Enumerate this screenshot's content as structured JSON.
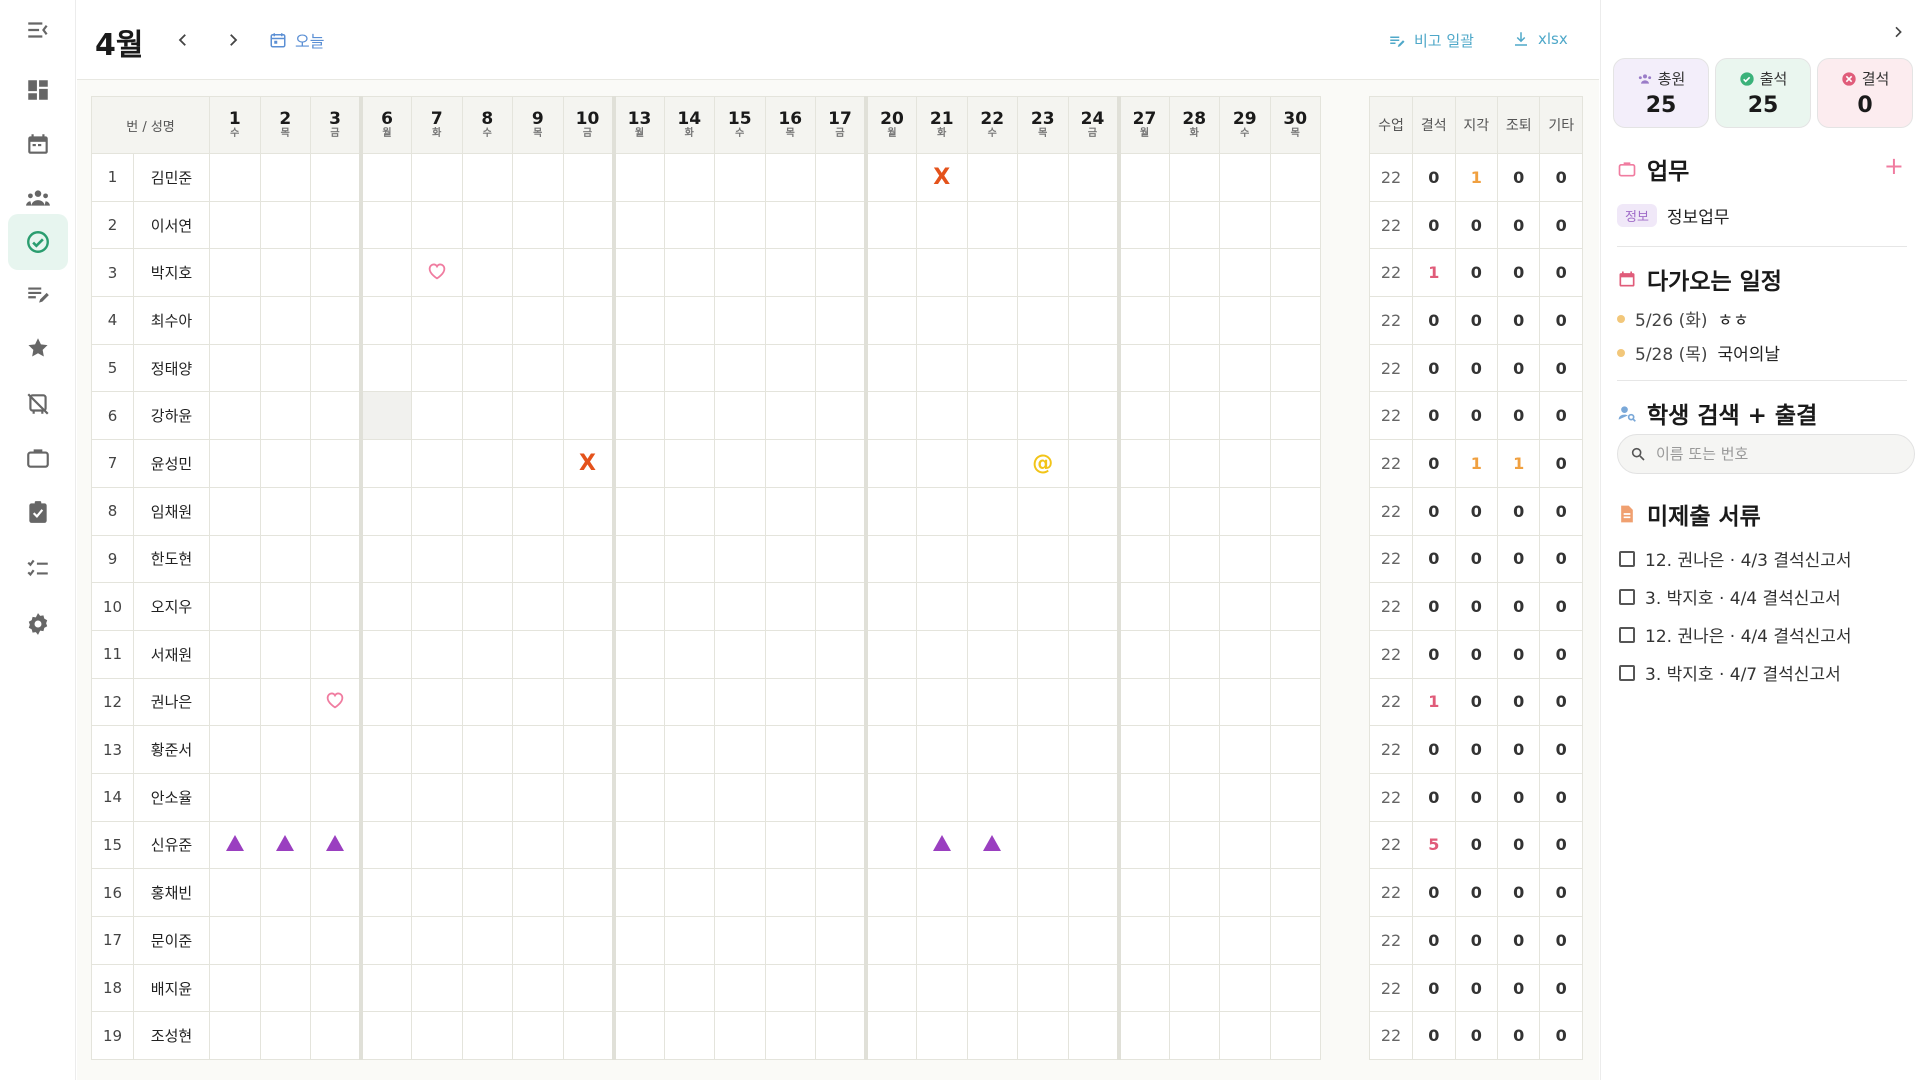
{
  "colors": {
    "accent": "#2a9d6f",
    "absent": "#e4521b",
    "red": "#e05c7a",
    "orange": "#f0a040",
    "purple": "#9a3fc0",
    "pink": "#f07ca0",
    "yellow": "#f2c418"
  },
  "nav": {
    "items": [
      "menu-collapse-icon",
      "dashboard-icon",
      "calendar-icon",
      "group-icon",
      "check-circle-icon",
      "edit-note-icon",
      "star-icon",
      "no-transfer-icon",
      "briefcase-icon",
      "assignment-icon",
      "checklist-icon",
      "settings-icon"
    ]
  },
  "topbar": {
    "month": "4월",
    "today_label": "오늘",
    "notes_label": "비고 일괄",
    "export_label": "xlsx"
  },
  "table": {
    "name_header": "번 / 성명",
    "days": [
      {
        "d": "1",
        "w": "수"
      },
      {
        "d": "2",
        "w": "목"
      },
      {
        "d": "3",
        "w": "금"
      },
      {
        "d": "6",
        "w": "월"
      },
      {
        "d": "7",
        "w": "화"
      },
      {
        "d": "8",
        "w": "수"
      },
      {
        "d": "9",
        "w": "목"
      },
      {
        "d": "10",
        "w": "금"
      },
      {
        "d": "13",
        "w": "월"
      },
      {
        "d": "14",
        "w": "화"
      },
      {
        "d": "15",
        "w": "수"
      },
      {
        "d": "16",
        "w": "목"
      },
      {
        "d": "17",
        "w": "금"
      },
      {
        "d": "20",
        "w": "월"
      },
      {
        "d": "21",
        "w": "화"
      },
      {
        "d": "22",
        "w": "수"
      },
      {
        "d": "23",
        "w": "목"
      },
      {
        "d": "24",
        "w": "금"
      },
      {
        "d": "27",
        "w": "월"
      },
      {
        "d": "28",
        "w": "화"
      },
      {
        "d": "29",
        "w": "수"
      },
      {
        "d": "30",
        "w": "목"
      }
    ],
    "stat_headers": [
      "수업",
      "결석",
      "지각",
      "조퇴",
      "기타"
    ],
    "students": [
      {
        "no": "1",
        "name": "김민준",
        "stats": [
          "22",
          "0",
          "1",
          "0",
          "0"
        ]
      },
      {
        "no": "2",
        "name": "이서연",
        "stats": [
          "22",
          "0",
          "0",
          "0",
          "0"
        ]
      },
      {
        "no": "3",
        "name": "박지호",
        "stats": [
          "22",
          "1",
          "0",
          "0",
          "0"
        ]
      },
      {
        "no": "4",
        "name": "최수아",
        "stats": [
          "22",
          "0",
          "0",
          "0",
          "0"
        ]
      },
      {
        "no": "5",
        "name": "정태양",
        "stats": [
          "22",
          "0",
          "0",
          "0",
          "0"
        ]
      },
      {
        "no": "6",
        "name": "강하윤",
        "stats": [
          "22",
          "0",
          "0",
          "0",
          "0"
        ]
      },
      {
        "no": "7",
        "name": "윤성민",
        "stats": [
          "22",
          "0",
          "1",
          "1",
          "0"
        ]
      },
      {
        "no": "8",
        "name": "임채원",
        "stats": [
          "22",
          "0",
          "0",
          "0",
          "0"
        ]
      },
      {
        "no": "9",
        "name": "한도현",
        "stats": [
          "22",
          "0",
          "0",
          "0",
          "0"
        ]
      },
      {
        "no": "10",
        "name": "오지우",
        "stats": [
          "22",
          "0",
          "0",
          "0",
          "0"
        ]
      },
      {
        "no": "11",
        "name": "서재원",
        "stats": [
          "22",
          "0",
          "0",
          "0",
          "0"
        ]
      },
      {
        "no": "12",
        "name": "권나은",
        "stats": [
          "22",
          "1",
          "0",
          "0",
          "0"
        ]
      },
      {
        "no": "13",
        "name": "황준서",
        "stats": [
          "22",
          "0",
          "0",
          "0",
          "0"
        ]
      },
      {
        "no": "14",
        "name": "안소율",
        "stats": [
          "22",
          "0",
          "0",
          "0",
          "0"
        ]
      },
      {
        "no": "15",
        "name": "신유준",
        "stats": [
          "22",
          "5",
          "0",
          "0",
          "0"
        ]
      },
      {
        "no": "16",
        "name": "홍채빈",
        "stats": [
          "22",
          "0",
          "0",
          "0",
          "0"
        ]
      },
      {
        "no": "17",
        "name": "문이준",
        "stats": [
          "22",
          "0",
          "0",
          "0",
          "0"
        ]
      },
      {
        "no": "18",
        "name": "배지윤",
        "stats": [
          "22",
          "0",
          "0",
          "0",
          "0"
        ]
      },
      {
        "no": "19",
        "name": "조성현",
        "stats": [
          "22",
          "0",
          "0",
          "0",
          "0"
        ]
      }
    ],
    "marks": [
      {
        "row": 0,
        "day": "21",
        "type": "x",
        "text": "X"
      },
      {
        "row": 2,
        "day": "7",
        "type": "heart"
      },
      {
        "row": 5,
        "day": "6",
        "type": "shade"
      },
      {
        "row": 6,
        "day": "10",
        "type": "x",
        "text": "X"
      },
      {
        "row": 6,
        "day": "23",
        "type": "at",
        "text": "@"
      },
      {
        "row": 11,
        "day": "3",
        "type": "heart"
      },
      {
        "row": 14,
        "day": "1",
        "type": "triangle"
      },
      {
        "row": 14,
        "day": "2",
        "type": "triangle"
      },
      {
        "row": 14,
        "day": "3",
        "type": "triangle"
      },
      {
        "row": 14,
        "day": "21",
        "type": "triangle"
      },
      {
        "row": 14,
        "day": "22",
        "type": "triangle"
      }
    ]
  },
  "panel": {
    "cards": [
      {
        "label": "총원",
        "value": "25",
        "bg": "#f3eefa",
        "icon": "group-icon"
      },
      {
        "label": "출석",
        "value": "25",
        "bg": "#eaf6ef",
        "icon": "check-circle-icon"
      },
      {
        "label": "결석",
        "value": "0",
        "bg": "#fcecef",
        "icon": "cancel-circle-icon"
      }
    ],
    "tasks_title": "업무",
    "task_chip": "정보",
    "task_text": "정보업무",
    "upcoming_title": "다가오는 일정",
    "events": [
      {
        "date": "5/26 (화)",
        "text": "ㅎㅎ"
      },
      {
        "date": "5/28 (목)",
        "text": "국어의날"
      }
    ],
    "search_title": "학생 검색 + 출결",
    "search_placeholder": "이름 또는 번호",
    "docs_title": "미제출 서류",
    "docs": [
      "12. 권나은 · 4/3 결석신고서",
      "3. 박지호 · 4/4 결석신고서",
      "12. 권나은 · 4/4 결석신고서",
      "3. 박지호 · 4/7 결석신고서"
    ]
  }
}
